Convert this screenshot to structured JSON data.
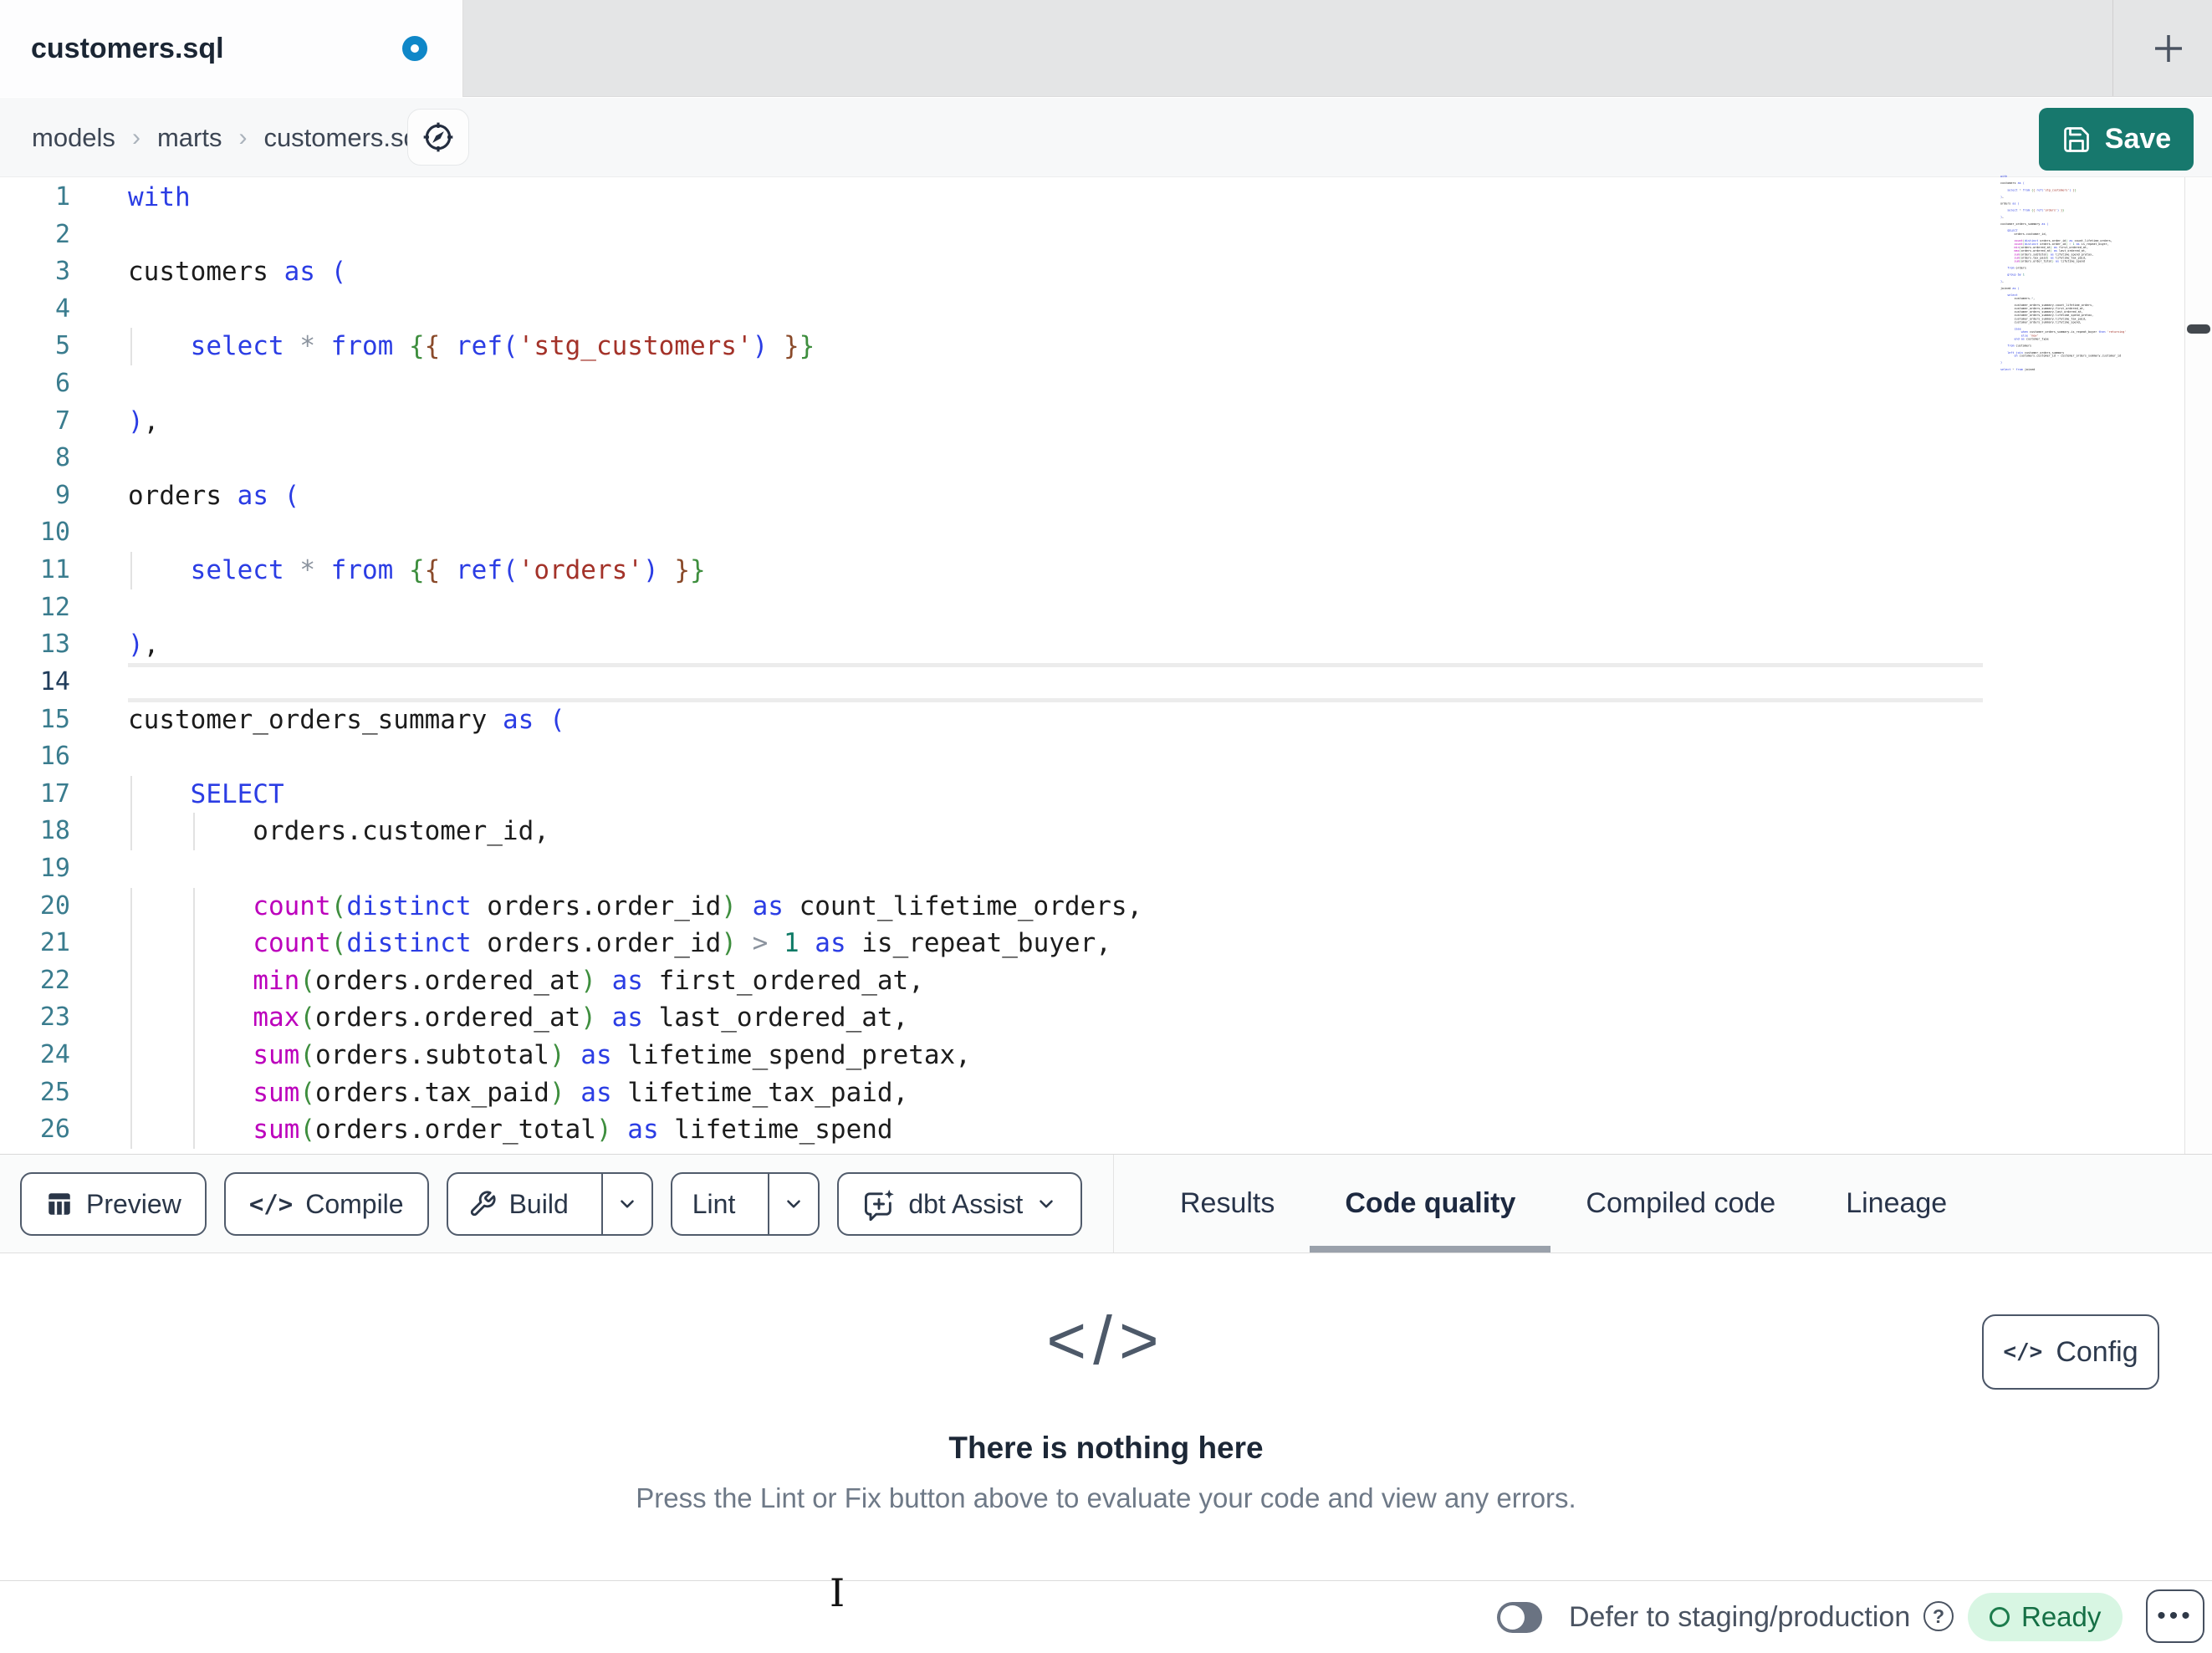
{
  "tab_bar": {
    "active_tab_label": "customers.sql",
    "unsaved_dot_color": "#0f87c8",
    "new_tab_glyph": "+"
  },
  "breadcrumb": {
    "items": [
      "models",
      "marts",
      "customers.sql"
    ],
    "separator": "›"
  },
  "header": {
    "save_label": "Save",
    "save_color": "#17786d"
  },
  "editor": {
    "active_line": 14,
    "line_number_color": "#3a7c8e",
    "active_line_number_color": "#1f3b5a",
    "token_colors": {
      "keyword": "#2b3de4",
      "function": "#bc00bc",
      "string": "#a33229",
      "number": "#0e7a66",
      "operator": "#8b939e",
      "jinja_outer": "#3e8e3e",
      "jinja_inner": "#8a4a2a",
      "paren": "#3e8e3e",
      "text": "#1c1c1c"
    },
    "lines": [
      {
        "t": [
          [
            "kw",
            "with"
          ]
        ]
      },
      {
        "t": []
      },
      {
        "t": [
          [
            "txt",
            "customers "
          ],
          [
            "kw",
            "as"
          ],
          [
            "txt",
            " "
          ],
          [
            "kw",
            "("
          ]
        ]
      },
      {
        "t": [],
        "g": [
          0
        ]
      },
      {
        "t": [
          [
            "txt",
            "    "
          ],
          [
            "kw",
            "select"
          ],
          [
            "txt",
            " "
          ],
          [
            "op",
            "*"
          ],
          [
            "txt",
            " "
          ],
          [
            "kw",
            "from"
          ],
          [
            "txt",
            " "
          ],
          [
            "jg",
            "{"
          ],
          [
            "jb",
            "{"
          ],
          [
            "txt",
            " "
          ],
          [
            "kw",
            "ref("
          ],
          [
            "str",
            "'stg_customers'"
          ],
          [
            "kw",
            ")"
          ],
          [
            "txt",
            " "
          ],
          [
            "jb",
            "}"
          ],
          [
            "jg",
            "}"
          ]
        ],
        "g": [
          0
        ]
      },
      {
        "t": [],
        "g": [
          0
        ]
      },
      {
        "t": [
          [
            "kw",
            ")"
          ],
          [
            "txt",
            ","
          ]
        ]
      },
      {
        "t": []
      },
      {
        "t": [
          [
            "txt",
            "orders "
          ],
          [
            "kw",
            "as"
          ],
          [
            "txt",
            " "
          ],
          [
            "kw",
            "("
          ]
        ]
      },
      {
        "t": [],
        "g": [
          0
        ]
      },
      {
        "t": [
          [
            "txt",
            "    "
          ],
          [
            "kw",
            "select"
          ],
          [
            "txt",
            " "
          ],
          [
            "op",
            "*"
          ],
          [
            "txt",
            " "
          ],
          [
            "kw",
            "from"
          ],
          [
            "txt",
            " "
          ],
          [
            "jg",
            "{"
          ],
          [
            "jb",
            "{"
          ],
          [
            "txt",
            " "
          ],
          [
            "kw",
            "ref("
          ],
          [
            "str",
            "'orders'"
          ],
          [
            "kw",
            ")"
          ],
          [
            "txt",
            " "
          ],
          [
            "jb",
            "}"
          ],
          [
            "jg",
            "}"
          ]
        ],
        "g": [
          0
        ]
      },
      {
        "t": [],
        "g": [
          0
        ]
      },
      {
        "t": [
          [
            "kw",
            ")"
          ],
          [
            "txt",
            ","
          ]
        ]
      },
      {
        "t": []
      },
      {
        "t": [
          [
            "txt",
            "customer_orders_summary "
          ],
          [
            "kw",
            "as"
          ],
          [
            "txt",
            " "
          ],
          [
            "kw",
            "("
          ]
        ]
      },
      {
        "t": [],
        "g": [
          0
        ]
      },
      {
        "t": [
          [
            "txt",
            "    "
          ],
          [
            "kw",
            "SELECT"
          ]
        ],
        "g": [
          0
        ]
      },
      {
        "t": [
          [
            "txt",
            "        orders.customer_id,"
          ]
        ],
        "g": [
          0,
          4
        ]
      },
      {
        "t": [],
        "g": [
          0,
          4
        ]
      },
      {
        "t": [
          [
            "txt",
            "        "
          ],
          [
            "fn",
            "count"
          ],
          [
            "pg",
            "("
          ],
          [
            "kw",
            "distinct"
          ],
          [
            "txt",
            " orders.order_id"
          ],
          [
            "pg",
            ")"
          ],
          [
            "txt",
            " "
          ],
          [
            "kw",
            "as"
          ],
          [
            "txt",
            " count_lifetime_orders,"
          ]
        ],
        "g": [
          0,
          4
        ]
      },
      {
        "t": [
          [
            "txt",
            "        "
          ],
          [
            "fn",
            "count"
          ],
          [
            "pg",
            "("
          ],
          [
            "kw",
            "distinct"
          ],
          [
            "txt",
            " orders.order_id"
          ],
          [
            "pg",
            ")"
          ],
          [
            "txt",
            " "
          ],
          [
            "op",
            ">"
          ],
          [
            "txt",
            " "
          ],
          [
            "num",
            "1"
          ],
          [
            "txt",
            " "
          ],
          [
            "kw",
            "as"
          ],
          [
            "txt",
            " is_repeat_buyer,"
          ]
        ],
        "g": [
          0,
          4
        ]
      },
      {
        "t": [
          [
            "txt",
            "        "
          ],
          [
            "fn",
            "min"
          ],
          [
            "pg",
            "("
          ],
          [
            "txt",
            "orders.ordered_at"
          ],
          [
            "pg",
            ")"
          ],
          [
            "txt",
            " "
          ],
          [
            "kw",
            "as"
          ],
          [
            "txt",
            " first_ordered_at,"
          ]
        ],
        "g": [
          0,
          4
        ]
      },
      {
        "t": [
          [
            "txt",
            "        "
          ],
          [
            "fn",
            "max"
          ],
          [
            "pg",
            "("
          ],
          [
            "txt",
            "orders.ordered_at"
          ],
          [
            "pg",
            ")"
          ],
          [
            "txt",
            " "
          ],
          [
            "kw",
            "as"
          ],
          [
            "txt",
            " last_ordered_at,"
          ]
        ],
        "g": [
          0,
          4
        ]
      },
      {
        "t": [
          [
            "txt",
            "        "
          ],
          [
            "fn",
            "sum"
          ],
          [
            "pg",
            "("
          ],
          [
            "txt",
            "orders.subtotal"
          ],
          [
            "pg",
            ")"
          ],
          [
            "txt",
            " "
          ],
          [
            "kw",
            "as"
          ],
          [
            "txt",
            " lifetime_spend_pretax,"
          ]
        ],
        "g": [
          0,
          4
        ]
      },
      {
        "t": [
          [
            "txt",
            "        "
          ],
          [
            "fn",
            "sum"
          ],
          [
            "pg",
            "("
          ],
          [
            "txt",
            "orders.tax_paid"
          ],
          [
            "pg",
            ")"
          ],
          [
            "txt",
            " "
          ],
          [
            "kw",
            "as"
          ],
          [
            "txt",
            " lifetime_tax_paid,"
          ]
        ],
        "g": [
          0,
          4
        ]
      },
      {
        "t": [
          [
            "txt",
            "        "
          ],
          [
            "fn",
            "sum"
          ],
          [
            "pg",
            "("
          ],
          [
            "txt",
            "orders.order_total"
          ],
          [
            "pg",
            ")"
          ],
          [
            "txt",
            " "
          ],
          [
            "kw",
            "as"
          ],
          [
            "txt",
            " lifetime_spend"
          ]
        ],
        "g": [
          0,
          4
        ]
      }
    ],
    "minimap_extra": [
      {
        "t": []
      },
      {
        "t": [
          [
            "txt",
            "    "
          ],
          [
            "kw",
            "from"
          ],
          [
            "txt",
            " orders"
          ]
        ]
      },
      {
        "t": []
      },
      {
        "t": [
          [
            "txt",
            "    "
          ],
          [
            "kw",
            "group by"
          ],
          [
            "txt",
            " "
          ],
          [
            "num",
            "1"
          ]
        ]
      },
      {
        "t": []
      },
      {
        "t": [
          [
            "kw",
            ")"
          ],
          [
            "txt",
            ","
          ]
        ]
      },
      {
        "t": []
      },
      {
        "t": [
          [
            "txt",
            "joined "
          ],
          [
            "kw",
            "as"
          ],
          [
            "txt",
            " "
          ],
          [
            "kw",
            "("
          ]
        ]
      },
      {
        "t": []
      },
      {
        "t": [
          [
            "txt",
            "    "
          ],
          [
            "kw",
            "select"
          ]
        ]
      },
      {
        "t": [
          [
            "txt",
            "        customers."
          ],
          [
            "op",
            "*"
          ],
          [
            "txt",
            ","
          ]
        ]
      },
      {
        "t": []
      },
      {
        "t": [
          [
            "txt",
            "        customer_orders_summary.count_lifetime_orders,"
          ]
        ]
      },
      {
        "t": [
          [
            "txt",
            "        customer_orders_summary.first_ordered_at,"
          ]
        ]
      },
      {
        "t": [
          [
            "txt",
            "        customer_orders_summary.last_ordered_at,"
          ]
        ]
      },
      {
        "t": [
          [
            "txt",
            "        customer_orders_summary.lifetime_spend_pretax,"
          ]
        ]
      },
      {
        "t": [
          [
            "txt",
            "        customer_orders_summary.lifetime_tax_paid,"
          ]
        ]
      },
      {
        "t": [
          [
            "txt",
            "        customer_orders_summary.lifetime_spend,"
          ]
        ]
      },
      {
        "t": []
      },
      {
        "t": [
          [
            "txt",
            "        "
          ],
          [
            "kw",
            "case"
          ]
        ]
      },
      {
        "t": [
          [
            "txt",
            "            "
          ],
          [
            "kw",
            "when"
          ],
          [
            "txt",
            " customer_orders_summary.is_repeat_buyer "
          ],
          [
            "kw",
            "then"
          ],
          [
            "txt",
            " "
          ],
          [
            "str",
            "'returning'"
          ]
        ]
      },
      {
        "t": [
          [
            "txt",
            "            "
          ],
          [
            "kw",
            "else"
          ],
          [
            "txt",
            " "
          ],
          [
            "str",
            "'new'"
          ]
        ]
      },
      {
        "t": [
          [
            "txt",
            "        "
          ],
          [
            "kw",
            "end"
          ],
          [
            "txt",
            " "
          ],
          [
            "kw",
            "as"
          ],
          [
            "txt",
            " customer_type"
          ]
        ]
      },
      {
        "t": []
      },
      {
        "t": [
          [
            "txt",
            "    "
          ],
          [
            "kw",
            "from"
          ],
          [
            "txt",
            " customers"
          ]
        ]
      },
      {
        "t": []
      },
      {
        "t": [
          [
            "txt",
            "    "
          ],
          [
            "kw",
            "left join"
          ],
          [
            "txt",
            " customer_orders_summary"
          ]
        ]
      },
      {
        "t": [
          [
            "txt",
            "        "
          ],
          [
            "kw",
            "on"
          ],
          [
            "txt",
            " customers.customer_id "
          ],
          [
            "op",
            "="
          ],
          [
            "txt",
            " customer_orders_summary.customer_id"
          ]
        ]
      },
      {
        "t": []
      },
      {
        "t": [
          [
            "kw",
            ")"
          ]
        ]
      },
      {
        "t": []
      },
      {
        "t": [
          [
            "kw",
            "select"
          ],
          [
            "txt",
            " "
          ],
          [
            "op",
            "*"
          ],
          [
            "txt",
            " "
          ],
          [
            "kw",
            "from"
          ],
          [
            "txt",
            " joined"
          ]
        ]
      }
    ]
  },
  "toolbar": {
    "preview_label": "Preview",
    "compile_label": "Compile",
    "compile_icon_glyph": "</>",
    "build_label": "Build",
    "lint_label": "Lint",
    "assist_label": "dbt Assist"
  },
  "result_tabs": {
    "items": [
      {
        "label": "Results",
        "active": false
      },
      {
        "label": "Code quality",
        "active": true
      },
      {
        "label": "Compiled code",
        "active": false
      },
      {
        "label": "Lineage",
        "active": false
      }
    ]
  },
  "panel": {
    "icon_glyph": "</>",
    "title": "There is nothing here",
    "subtitle": "Press the Lint or Fix button above to evaluate your code and view any errors.",
    "config_icon_glyph": "</>",
    "config_label": "Config"
  },
  "status_bar": {
    "defer_label": "Defer to staging/production",
    "help_glyph": "?",
    "ready_label": "Ready",
    "ready_bg": "#d8f6e3",
    "ready_fg": "#156f45",
    "menu_glyph": "•••"
  },
  "cursor": {
    "glyph": "I"
  }
}
